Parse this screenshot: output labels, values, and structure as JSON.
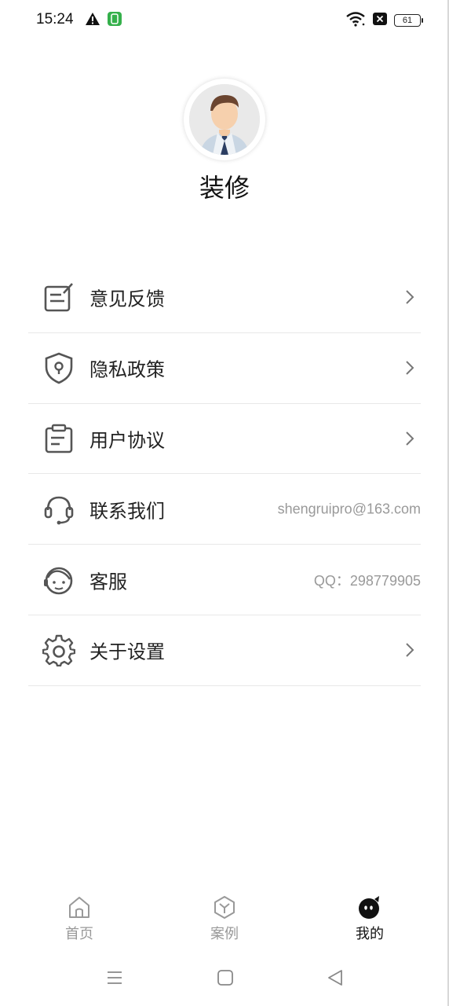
{
  "status_bar": {
    "time": "15:24",
    "battery_level": "61",
    "icons": [
      "warning-icon",
      "app-notification-icon",
      "wifi-icon",
      "sim-off-icon",
      "battery-icon"
    ]
  },
  "profile": {
    "name": "装修",
    "avatar": "businessman-avatar"
  },
  "menu": {
    "items": [
      {
        "label": "意见反馈",
        "icon": "feedback-icon",
        "value": "",
        "chevron": true
      },
      {
        "label": "隐私政策",
        "icon": "shield-icon",
        "value": "",
        "chevron": true
      },
      {
        "label": "用户协议",
        "icon": "clipboard-icon",
        "value": "",
        "chevron": true
      },
      {
        "label": "联系我们",
        "icon": "headset-icon",
        "value": "shengruipro@163.com",
        "chevron": false
      },
      {
        "label": "客服",
        "icon": "customer-service-icon",
        "value": "QQ：298779905",
        "chevron": false
      },
      {
        "label": "关于设置",
        "icon": "gear-icon",
        "value": "",
        "chevron": true
      }
    ]
  },
  "tab_bar": {
    "tabs": [
      {
        "label": "首页",
        "icon": "home-icon",
        "active": false
      },
      {
        "label": "案例",
        "icon": "cube-icon",
        "active": false
      },
      {
        "label": "我的",
        "icon": "profile-face-icon",
        "active": true
      }
    ]
  },
  "nav_bar": {
    "buttons": [
      "menu-icon",
      "home-square-icon",
      "back-triangle-icon"
    ]
  }
}
